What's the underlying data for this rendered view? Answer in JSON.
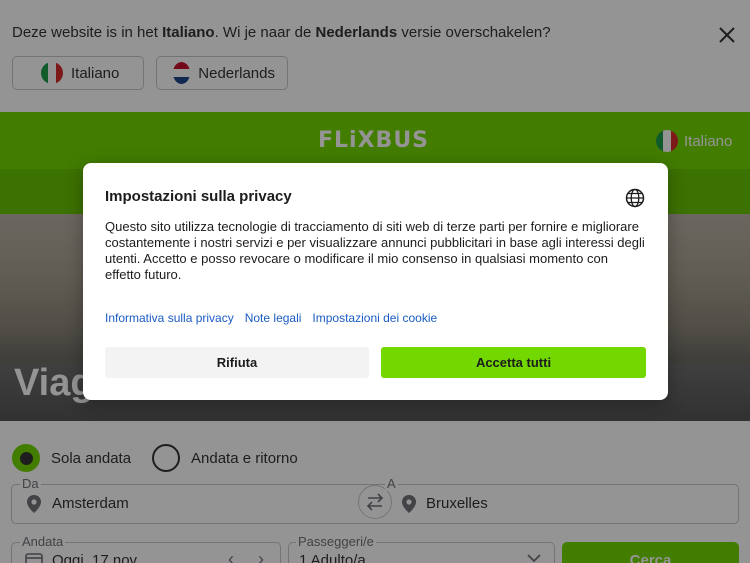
{
  "language_banner": {
    "message_prefix": "Deze website is in het ",
    "current_language": "Italiano",
    "message_middle": ". Wi je naar de ",
    "target_language": "Nederlands",
    "message_suffix": " versie overschakelen?",
    "buttons": [
      {
        "label": "Italiano",
        "flag": "italy-flag-icon"
      },
      {
        "label": "Nederlands",
        "flag": "netherlands-flag-icon"
      }
    ],
    "close_icon": "close-icon"
  },
  "header": {
    "logo_text": "FLiXBUS",
    "language_label": "Italiano",
    "brand_color": "#73d700"
  },
  "hero": {
    "title": "Viag"
  },
  "search": {
    "trip_types": [
      {
        "label": "Sola andata",
        "selected": true
      },
      {
        "label": "Andata e ritorno",
        "selected": false
      }
    ],
    "from_label": "Da",
    "from_value": "Amsterdam",
    "to_label": "A",
    "to_value": "Bruxelles",
    "departure_label": "Andata",
    "departure_value": "Oggi, 17 nov",
    "passengers_label": "Passeggeri/e",
    "passengers_value": "1 Adulto/a",
    "search_button": "Cerca"
  },
  "privacy_modal": {
    "title": "Impostazioni sulla privacy",
    "body": "Questo sito utilizza tecnologie di tracciamento di siti web di terze parti per fornire e migliorare costantemente i nostri servizi e per visualizzare annunci pubblicitari in base agli interessi degli utenti. Accetto e posso revocare o modificare il mio consenso in qualsiasi momento con effetto futuro.",
    "links": [
      "Informativa sulla privacy",
      "Note legali",
      "Impostazioni dei cookie"
    ],
    "deny_button": "Rifiuta",
    "accept_button": "Accetta tutti",
    "link_color": "#1a5cc4",
    "accept_color": "#73d700"
  }
}
